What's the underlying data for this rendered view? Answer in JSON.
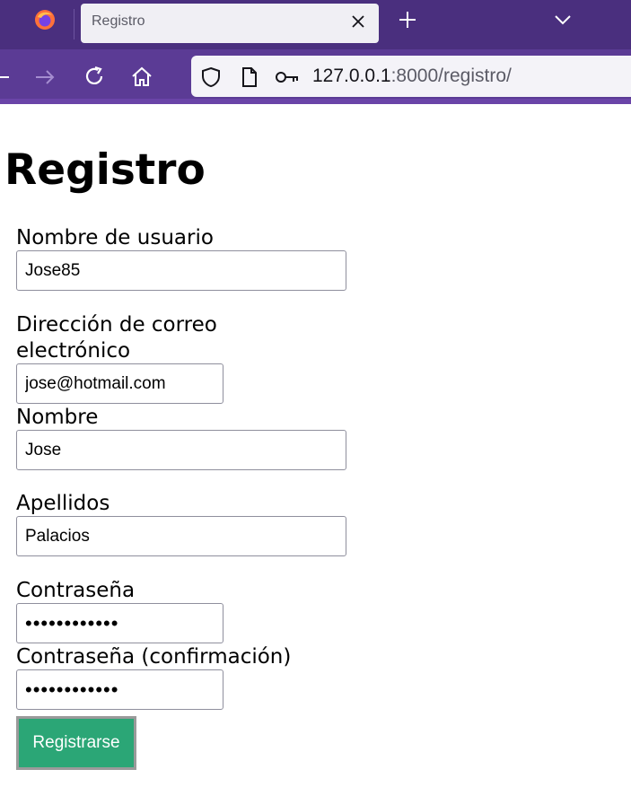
{
  "browser": {
    "tab_title": "Registro",
    "url_host": "127.0.0.1",
    "url_rest": ":8000/registro/"
  },
  "page": {
    "title": "Registro"
  },
  "form": {
    "username_label": "Nombre de usuario",
    "username_value": "Jose85",
    "email_label": "Dirección de correo electrónico",
    "email_value": "jose@hotmail.com",
    "first_name_label": "Nombre",
    "first_name_value": "Jose",
    "last_name_label": "Apellidos",
    "last_name_value": "Palacios",
    "password_label": "Contraseña",
    "password_value": "jose85passwo",
    "password_confirm_label": "Contraseña (confirmación)",
    "password_confirm_value": "jose85passwo",
    "submit_label": "Registrarse"
  },
  "colors": {
    "tabbar": "#4a2f7e",
    "navbar": "#5b3b95",
    "submit_button": "#2ba676"
  }
}
